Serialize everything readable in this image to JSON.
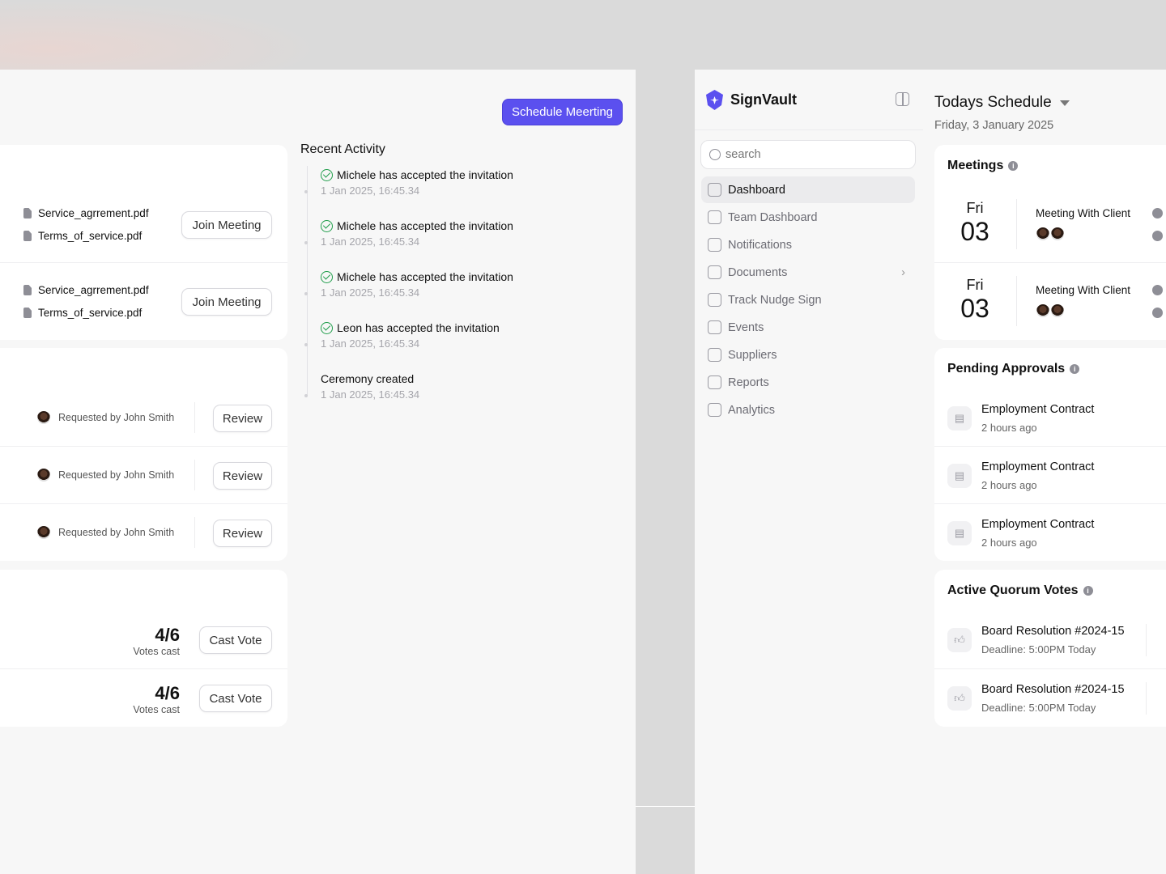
{
  "header": {
    "schedule_button": "Schedule Meerting"
  },
  "meetings_left": [
    {
      "files": [
        "Service_agrrement.pdf",
        "Terms_of_service.pdf"
      ],
      "button": "Join Meeting"
    },
    {
      "files": [
        "Service_agrrement.pdf",
        "Terms_of_service.pdf"
      ],
      "button": "Join Meeting"
    }
  ],
  "approvals_left": [
    {
      "requested": "Requested by John Smith",
      "button": "Review"
    },
    {
      "requested": "Requested by John Smith",
      "button": "Review"
    },
    {
      "requested": "Requested by John Smith",
      "button": "Review"
    }
  ],
  "votes_left": [
    {
      "count": "4/6",
      "label": "Votes cast",
      "button": "Cast Vote"
    },
    {
      "count": "4/6",
      "label": "Votes cast",
      "button": "Cast Vote"
    }
  ],
  "activity": {
    "title": "Recent Activity",
    "items": [
      {
        "text": "Michele has accepted the invitation",
        "time": "1 Jan 2025, 16:45.34",
        "check": true
      },
      {
        "text": "Michele has accepted the invitation",
        "time": "1 Jan 2025, 16:45.34",
        "check": true
      },
      {
        "text": "Michele has accepted the invitation",
        "time": "1 Jan 2025, 16:45.34",
        "check": true
      },
      {
        "text": "Leon has accepted the invitation",
        "time": "1 Jan 2025, 16:45.34",
        "check": true
      },
      {
        "text": "Ceremony created",
        "time": "1 Jan 2025, 16:45.34",
        "check": false
      }
    ]
  },
  "sidebar": {
    "brand": "SignVault",
    "brand_color": "#5b50ef",
    "search_placeholder": "search",
    "items": [
      {
        "label": "Dashboard",
        "icon": "dashboard-icon",
        "active": true
      },
      {
        "label": "Team Dashboard",
        "icon": "team-icon"
      },
      {
        "label": "Notifications",
        "icon": "bell-icon"
      },
      {
        "label": "Documents",
        "icon": "document-icon",
        "chevron": true
      },
      {
        "label": "Track Nudge Sign",
        "icon": "track-icon"
      },
      {
        "label": "Events",
        "icon": "events-icon"
      },
      {
        "label": "Suppliers",
        "icon": "suppliers-icon"
      },
      {
        "label": "Reports",
        "icon": "reports-icon"
      },
      {
        "label": "Analytics",
        "icon": "analytics-icon"
      }
    ]
  },
  "schedule": {
    "title": "Todays Schedule",
    "date": "Friday, 3 January 2025",
    "meetings_title": "Meetings",
    "meetings": [
      {
        "day": "Fri",
        "date": "03",
        "title": "Meeting With Client"
      },
      {
        "day": "Fri",
        "date": "03",
        "title": "Meeting With Client"
      }
    ],
    "approvals_title": "Pending Approvals",
    "approvals": [
      {
        "title": "Employment Contract",
        "time": "2 hours ago"
      },
      {
        "title": "Employment Contract",
        "time": "2 hours ago"
      },
      {
        "title": "Employment Contract",
        "time": "2 hours ago"
      }
    ],
    "votes_title": "Active Quorum Votes",
    "votes": [
      {
        "title": "Board Resolution #2024-15",
        "deadline": "Deadline: 5:00PM Today"
      },
      {
        "title": "Board Resolution #2024-15",
        "deadline": "Deadline: 5:00PM Today"
      }
    ]
  }
}
